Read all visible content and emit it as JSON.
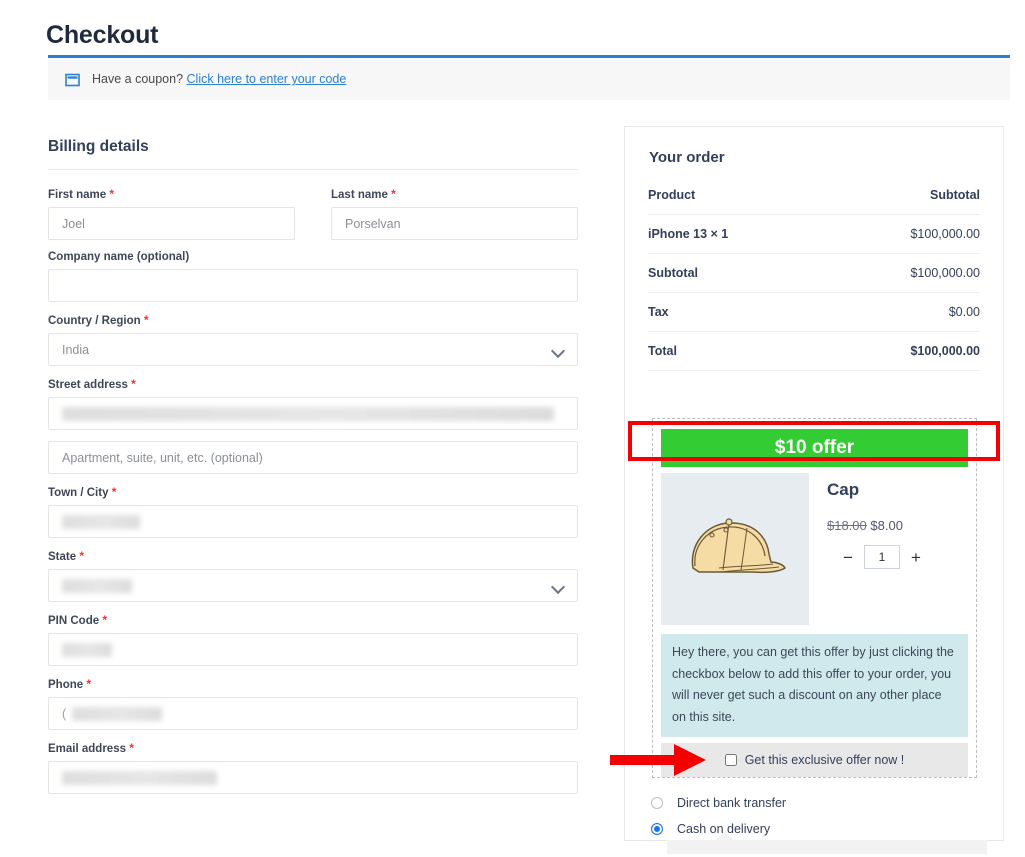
{
  "page": {
    "title": "Checkout"
  },
  "coupon": {
    "icon": "coupon-tag-icon",
    "text": "Have a coupon?",
    "link": "Click here to enter your code"
  },
  "billing": {
    "section_title": "Billing details",
    "fields": {
      "first_name": {
        "label": "First name",
        "required": "*",
        "value": "Joel"
      },
      "last_name": {
        "label": "Last name",
        "required": "*",
        "value": "Porselvan"
      },
      "company": {
        "label": "Company name (optional)",
        "value": ""
      },
      "country": {
        "label": "Country / Region",
        "required": "*",
        "value": "India"
      },
      "street": {
        "label": "Street address",
        "required": "*",
        "value": ""
      },
      "apartment": {
        "placeholder": "Apartment, suite, unit, etc. (optional)",
        "value": ""
      },
      "town": {
        "label": "Town / City",
        "required": "*",
        "value": ""
      },
      "state": {
        "label": "State",
        "required": "*",
        "value": ""
      },
      "pin": {
        "label": "PIN Code",
        "required": "*",
        "value": ""
      },
      "phone": {
        "label": "Phone",
        "required": "*",
        "value": "("
      },
      "email": {
        "label": "Email address",
        "required": "*",
        "value": ""
      }
    }
  },
  "order": {
    "title": "Your order",
    "columns": {
      "product": "Product",
      "subtotal": "Subtotal"
    },
    "rows": [
      {
        "label": "iPhone 13 × 1",
        "amount": "$100,000.00"
      },
      {
        "label": "Subtotal",
        "amount": "$100,000.00"
      },
      {
        "label": "Tax",
        "amount": "$0.00"
      },
      {
        "label": "Total",
        "amount": "$100,000.00"
      }
    ]
  },
  "offer": {
    "banner": "$10 offer",
    "product_name": "Cap",
    "price_old": "$18.00",
    "price_new": "$8.00",
    "qty_decrease": "−",
    "qty_value": "1",
    "qty_increase": "+",
    "note": "Hey there, you can get this offer by just clicking the checkbox below to add this offer to your order, you will never get such a discount on any other place on this site.",
    "checkbox_label": "Get this exclusive offer now !",
    "image_icon": "baseball-cap-image"
  },
  "payment": {
    "options": [
      {
        "label": "Direct bank transfer",
        "selected": false
      },
      {
        "label": "Cash on delivery",
        "selected": true
      }
    ]
  },
  "colors": {
    "accent_blue": "#2b7fd4",
    "offer_green": "#33cc33",
    "annotation_red": "#f40000",
    "required_red": "#ff2d2d",
    "note_teal": "#cfe9ec",
    "heading_navy": "#33405a"
  }
}
